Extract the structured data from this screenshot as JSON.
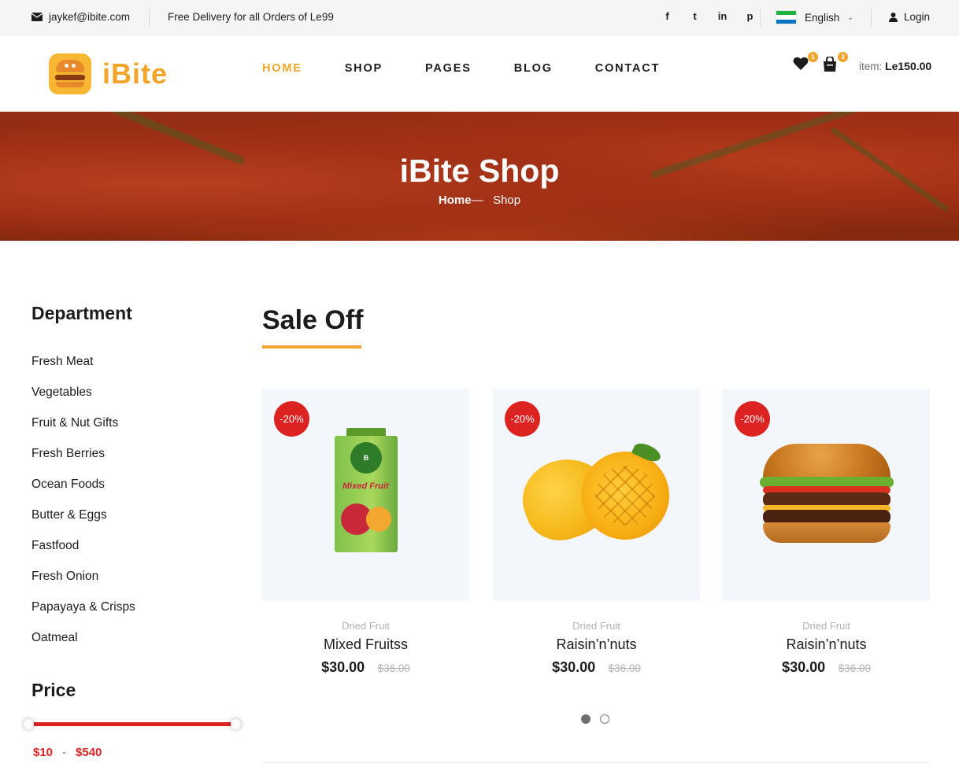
{
  "topbar": {
    "email": "jaykef@ibite.com",
    "delivery": "Free Delivery for all Orders of Le99",
    "socials": [
      "facebook-icon",
      "twitter-icon",
      "linkedin-icon",
      "pinterest-icon"
    ],
    "socials_glyphs": [
      "f",
      "t",
      "in",
      "p"
    ],
    "language": "English",
    "login": "Login"
  },
  "header": {
    "logo_text": "iBite",
    "nav": [
      "HOME",
      "SHOP",
      "PAGES",
      "BLOG",
      "CONTACT"
    ],
    "active_nav": "HOME",
    "wishlist_count": "1",
    "cart_count": "3",
    "cart_label": "item:",
    "cart_total": "Le150.00"
  },
  "hero": {
    "title": "iBite Shop",
    "breadcrumb_home": "Home",
    "breadcrumb_sep": "—",
    "breadcrumb_current": "Shop"
  },
  "sidebar": {
    "department_title": "Department",
    "departments": [
      "Fresh Meat",
      "Vegetables",
      "Fruit & Nut Gifts",
      "Fresh Berries",
      "Ocean Foods",
      "Butter & Eggs",
      "Fastfood",
      "Fresh Onion",
      "Papayaya & Crisps",
      "Oatmeal"
    ],
    "price_title": "Price",
    "price_min": "$10",
    "price_dash": "-",
    "price_max": "$540"
  },
  "sale": {
    "title": "Sale Off",
    "products": [
      {
        "discount": "-20%",
        "category": "Dried Fruit",
        "name": "Mixed Fruitss",
        "price": "$30.00",
        "old_price": "$36.00",
        "image": "juice-carton-image"
      },
      {
        "discount": "-20%",
        "category": "Dried Fruit",
        "name": "Raisin’n’nuts",
        "price": "$30.00",
        "old_price": "$36.00",
        "image": "mango-image"
      },
      {
        "discount": "-20%",
        "category": "Dried Fruit",
        "name": "Raisin’n’nuts",
        "price": "$30.00",
        "old_price": "$36.00",
        "image": "burger-image"
      }
    ],
    "carousel_pages": 2,
    "carousel_active": 1
  },
  "colors": {
    "accent": "#f3a42a",
    "sale_red": "#dd2222",
    "text": "#1c1c1c",
    "muted": "#b2b2b2",
    "topbar_bg": "#f5f5f5",
    "card_bg": "#f3f6fa"
  }
}
